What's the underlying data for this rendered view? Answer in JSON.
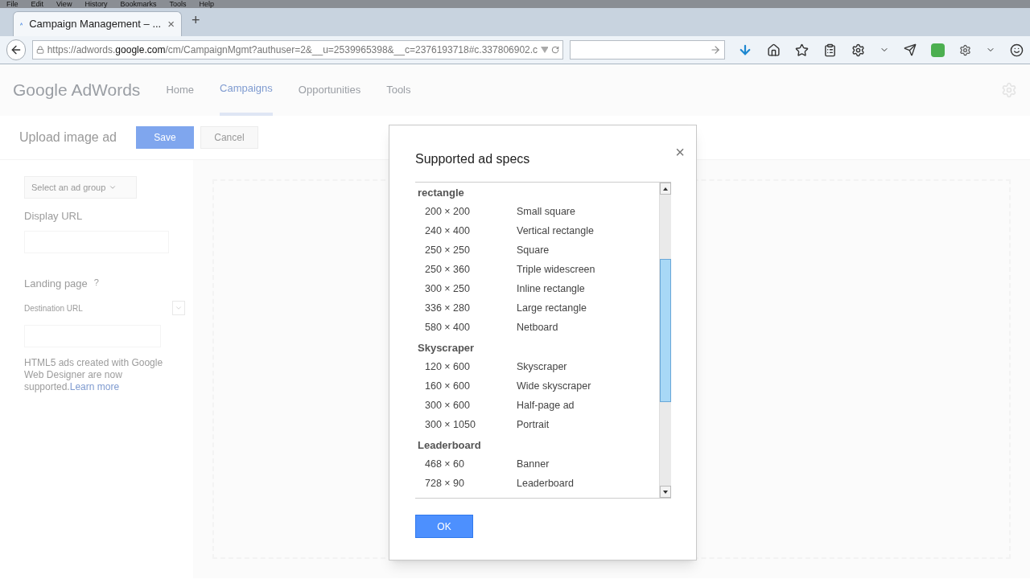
{
  "menu_bar": [
    "File",
    "Edit",
    "View",
    "History",
    "Bookmarks",
    "Tools",
    "Help"
  ],
  "browser_tab": {
    "title": "Campaign Management – ...",
    "close": "×",
    "new_tab": "+"
  },
  "address_bar": {
    "url_before": "https://adwords.",
    "url_domain": "google.com",
    "url_after": "/cm/CampaignMgmt?authuser=2&__u=2539965398&__c=2376193718#c.337806902.c"
  },
  "app": {
    "logo": "Google AdWords",
    "nav": [
      {
        "label": "Home",
        "selected": false
      },
      {
        "label": "Campaigns",
        "selected": true
      },
      {
        "label": "Opportunities",
        "selected": false
      },
      {
        "label": "Tools",
        "selected": false
      }
    ]
  },
  "page": {
    "title": "Upload image ad",
    "save": "Save",
    "cancel": "Cancel",
    "ad_group": "Select an ad group",
    "display_url_label": "Display URL",
    "landing_label": "Landing page",
    "help": "?",
    "destination_label": "Destination URL",
    "note": "HTML5 ads created with Google Web Designer are now supported.",
    "learn_more": "Learn more"
  },
  "dialog": {
    "title": "Supported ad specs",
    "close": "×",
    "ok": "OK",
    "sections": [
      {
        "title": "rectangle",
        "items": [
          {
            "size": "200 × 200",
            "name": "Small square"
          },
          {
            "size": "240 × 400",
            "name": "Vertical rectangle"
          },
          {
            "size": "250 × 250",
            "name": "Square"
          },
          {
            "size": "250 × 360",
            "name": "Triple widescreen"
          },
          {
            "size": "300 × 250",
            "name": "Inline rectangle"
          },
          {
            "size": "336 × 280",
            "name": "Large rectangle"
          },
          {
            "size": "580 × 400",
            "name": "Netboard"
          }
        ]
      },
      {
        "title": "Skyscraper",
        "items": [
          {
            "size": "120 × 600",
            "name": "Skyscraper"
          },
          {
            "size": "160 × 600",
            "name": "Wide skyscraper"
          },
          {
            "size": "300 × 600",
            "name": "Half-page ad"
          },
          {
            "size": "300 × 1050",
            "name": "Portrait"
          }
        ]
      },
      {
        "title": "Leaderboard",
        "items": [
          {
            "size": "468 × 60",
            "name": "Banner"
          },
          {
            "size": "728 × 90",
            "name": "Leaderboard"
          }
        ]
      }
    ]
  }
}
